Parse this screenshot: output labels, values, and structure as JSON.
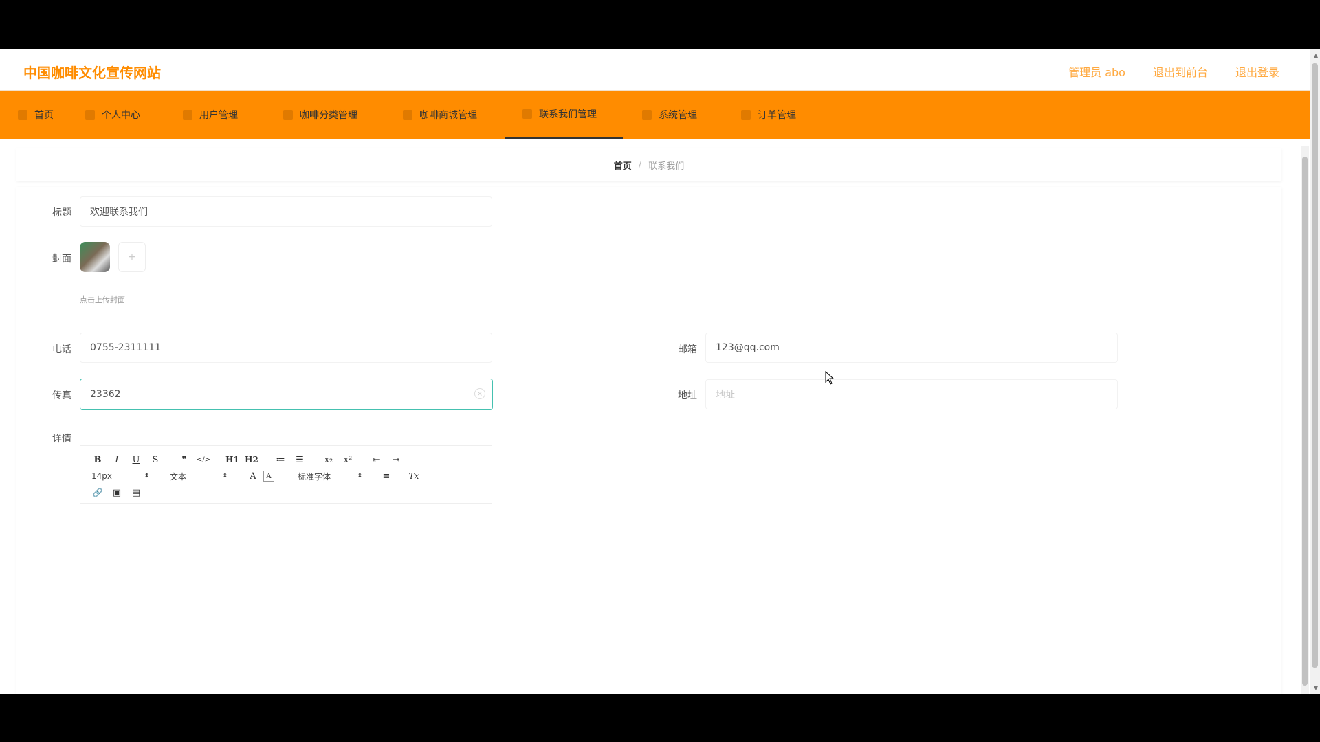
{
  "header": {
    "site_title": "中国咖啡文化宣传网站",
    "links": [
      {
        "label": "管理员 abo"
      },
      {
        "label": "退出到前台"
      },
      {
        "label": "退出登录"
      }
    ]
  },
  "nav": {
    "items": [
      {
        "label": "首页"
      },
      {
        "label": "个人中心"
      },
      {
        "label": "用户管理"
      },
      {
        "label": "咖啡分类管理"
      },
      {
        "label": "咖啡商城管理"
      },
      {
        "label": "联系我们管理"
      },
      {
        "label": "系统管理"
      },
      {
        "label": "订单管理"
      }
    ],
    "active_index": 5
  },
  "breadcrumb": {
    "home": "首页",
    "separator": "/",
    "current": "联系我们"
  },
  "form": {
    "title": {
      "label": "标题",
      "value": "欢迎联系我们"
    },
    "cover": {
      "label": "封面",
      "upload_icon": "plus-icon",
      "upload_symbol": "+",
      "hint": "点击上传封面"
    },
    "phone": {
      "label": "电话",
      "value": "0755-2311111"
    },
    "email": {
      "label": "邮箱",
      "value": "123@qq.com"
    },
    "fax": {
      "label": "传真",
      "value": "23362"
    },
    "address": {
      "label": "地址",
      "placeholder": "地址"
    },
    "details": {
      "label": "详情"
    }
  },
  "editor": {
    "toolbar": {
      "buttons_row1": [
        "B",
        "I",
        "U",
        "S",
        "❞",
        "</>",
        "H1",
        "H2",
        "≔",
        "☰",
        "x₂",
        "x²",
        "⇤",
        "⇥"
      ],
      "size_select": "14px",
      "header_select": "文本",
      "font_select": "标准字体",
      "buttons_row2_tail": [
        "A",
        "A",
        "≡",
        "Tx"
      ],
      "buttons_row3": [
        "🔗",
        "▣",
        "▤"
      ]
    }
  },
  "colors": {
    "accent": "#ff8c00",
    "focus_border": "#45c1b0"
  }
}
